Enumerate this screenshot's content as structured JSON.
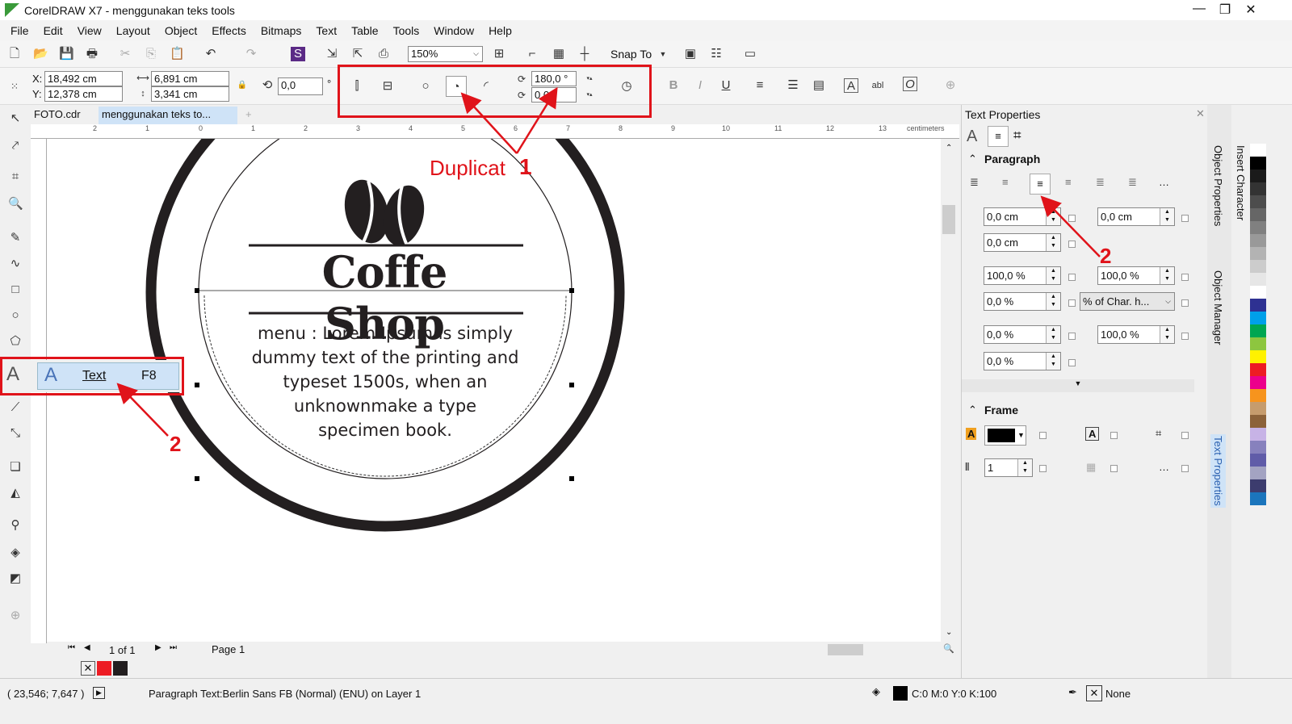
{
  "app": {
    "title": "CorelDRAW X7 - menggunakan teks tools"
  },
  "menu": [
    "File",
    "Edit",
    "View",
    "Layout",
    "Object",
    "Effects",
    "Bitmaps",
    "Text",
    "Table",
    "Tools",
    "Window",
    "Help"
  ],
  "toolbar": {
    "zoom": "150%",
    "snap_to": "Snap To"
  },
  "propbar": {
    "x": "18,492 cm",
    "y": "12,378 cm",
    "width": "6,891 cm",
    "height": "3,341 cm",
    "rotation": "0,0",
    "rotation_unit": "°",
    "start_angle": "180,0 °",
    "end_angle": "0,0 °",
    "x_label": "X:",
    "y_label": "Y:"
  },
  "doc_tabs": [
    "FOTO.cdr",
    "menggunakan teks to..."
  ],
  "ruler": {
    "unit": "centimeters",
    "ticks": [
      "2",
      "1",
      "0",
      "1",
      "2",
      "3",
      "4",
      "5",
      "6",
      "7",
      "8",
      "9",
      "10",
      "11",
      "12",
      "13"
    ]
  },
  "canvas": {
    "title": "Coffe Shop",
    "body_lines": [
      "menu : Lorem Ipsum is simply",
      "dummy text of the printing and",
      "typeset 1500s, when an",
      "unknownmake a type",
      "specimen book."
    ]
  },
  "flyout": {
    "label": "Text",
    "shortcut": "F8"
  },
  "annotations": {
    "duplicat": "Duplicat",
    "num1": "1",
    "num2a": "2",
    "num2b": "2"
  },
  "pagenav": {
    "count": "1 of 1",
    "page_tab": "Page 1"
  },
  "status": {
    "coords": "( 23,546; 7,647 )",
    "info": "Paragraph Text:Berlin Sans FB (Normal) (ENU) on Layer 1",
    "fill": "C:0 M:0 Y:0 K:100",
    "outline": "None"
  },
  "docker": {
    "title": "Text Properties",
    "paragraph": {
      "title": "Paragraph",
      "left_indent": "0,0 cm",
      "right_indent": "0,0 cm",
      "first_indent": "0,0 cm",
      "line_spacing": "100,0 %",
      "char_spacing_before": "100,0 %",
      "space_after": "0,0 %",
      "spacing_unit": "% of Char. h...",
      "word_spacing": "0,0 %",
      "language_spacing": "100,0 %",
      "char_spacing": "0,0 %"
    },
    "frame": {
      "title": "Frame",
      "columns": "1",
      "fill_color": "#000000"
    }
  },
  "vertical_tabs": [
    "Object Properties",
    "Object Manager",
    "Text Properties",
    "Insert Character"
  ],
  "colors": {
    "accent": "#e0131a",
    "ink": "#231f20",
    "palette": [
      "#ffffff",
      "#000000",
      "#1a1a1a",
      "#333333",
      "#4d4d4d",
      "#666666",
      "#808080",
      "#999999",
      "#b3b3b3",
      "#cccccc",
      "#e6e6e6",
      "#ffffff",
      "#2e3192",
      "#00a0e9",
      "#00a651",
      "#8dc63f",
      "#fff200",
      "#ed1c24",
      "#ec008c",
      "#f7941d",
      "#c69c6d",
      "#8c6239",
      "#c7b3e6",
      "#8781bd",
      "#605ca8",
      "#a3a3c2",
      "#3c3c6e",
      "#1b75bc"
    ]
  }
}
